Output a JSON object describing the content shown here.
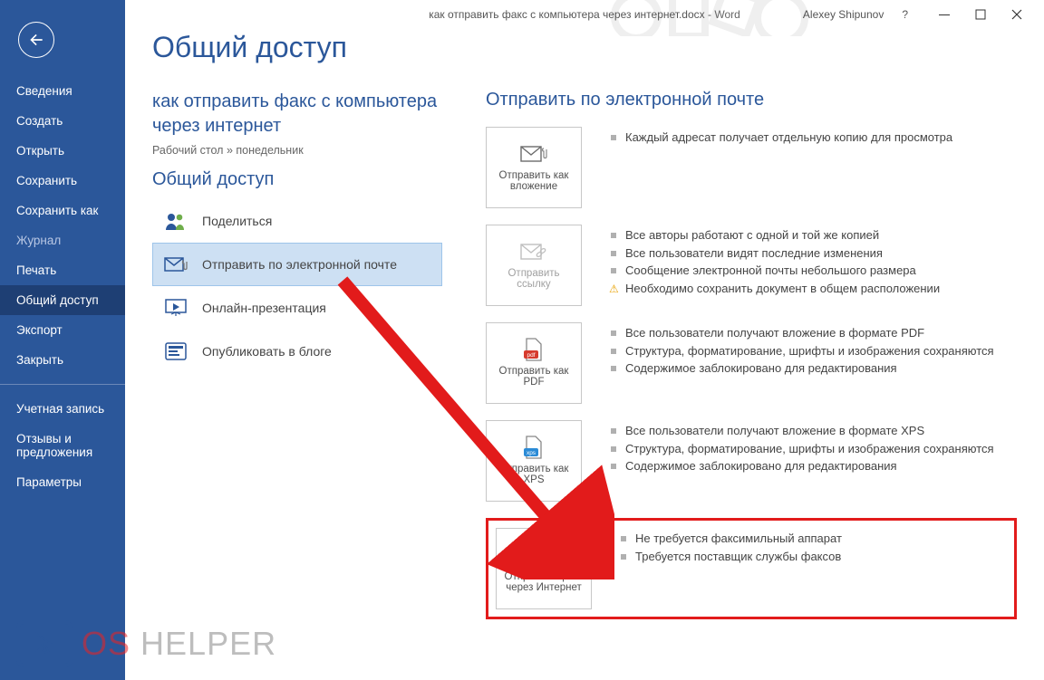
{
  "titlebar": {
    "document_name": "как отправить факс с компьютера через интернет.docx",
    "app_name": "Word",
    "user": "Alexey Shipunov",
    "help": "?"
  },
  "sidebar": {
    "items": [
      {
        "label": "Сведения"
      },
      {
        "label": "Создать"
      },
      {
        "label": "Открыть"
      },
      {
        "label": "Сохранить"
      },
      {
        "label": "Сохранить как"
      },
      {
        "label": "Журнал",
        "muted": true
      },
      {
        "label": "Печать"
      },
      {
        "label": "Общий доступ",
        "active": true
      },
      {
        "label": "Экспорт"
      },
      {
        "label": "Закрыть"
      }
    ],
    "footer": [
      {
        "label": "Учетная запись"
      },
      {
        "label": "Отзывы и предложения"
      },
      {
        "label": "Параметры"
      }
    ]
  },
  "page": {
    "title": "Общий доступ",
    "doc_title": "как отправить факс с компьютера через интернет",
    "breadcrumb": "Рабочий стол » понедельник",
    "left_heading": "Общий доступ",
    "share_items": [
      {
        "label": "Поделиться"
      },
      {
        "label": "Отправить по электронной почте",
        "selected": true
      },
      {
        "label": "Онлайн-презентация"
      },
      {
        "label": "Опубликовать в блоге"
      }
    ],
    "right_heading": "Отправить по электронной почте",
    "options": [
      {
        "tile": "Отправить как вложение",
        "bullets": [
          "Каждый адресат получает отдельную копию для просмотра"
        ]
      },
      {
        "tile": "Отправить ссылку",
        "disabled": true,
        "bullets": [
          "Все авторы работают с одной и той же копией",
          "Все пользователи видят последние изменения",
          "Сообщение электронной почты небольшого размера"
        ],
        "warn": "Необходимо сохранить документ в общем расположении"
      },
      {
        "tile": "Отправить как PDF",
        "bullets": [
          "Все пользователи получают вложение в формате PDF",
          "Структура, форматирование, шрифты и изображения сохраняются",
          "Содержимое заблокировано для редактирования"
        ]
      },
      {
        "tile": "Отправить как XPS",
        "bullets": [
          "Все пользователи получают вложение в формате XPS",
          "Структура, форматирование, шрифты и изображения сохраняются",
          "Содержимое заблокировано для редактирования"
        ]
      },
      {
        "tile": "Отправить факс через Интернет",
        "highlight": true,
        "bullets": [
          "Не требуется факсимильный аппарат",
          "Требуется поставщик службы факсов"
        ]
      }
    ]
  },
  "watermark": {
    "text_a": "OS",
    "text_b": "HELPER"
  }
}
